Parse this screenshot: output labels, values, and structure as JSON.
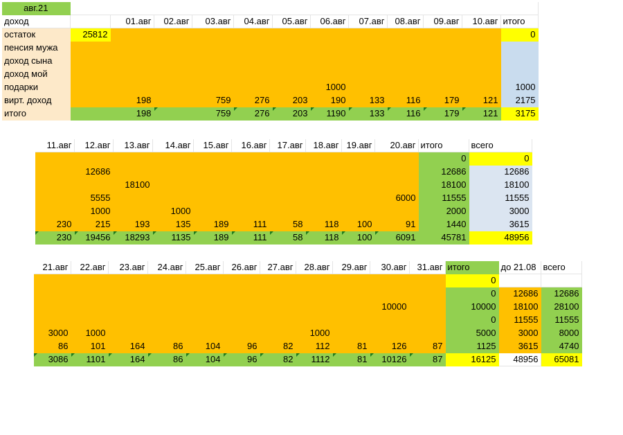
{
  "block1": {
    "title": "авг.21",
    "header": [
      "доход",
      "",
      "01.авг",
      "02.авг",
      "03.авг",
      "04.авг",
      "05.авг",
      "06.авг",
      "07.авг",
      "08.авг",
      "09.авг",
      "10.авг",
      "итого"
    ],
    "rows": [
      [
        "остаток",
        "25812",
        "",
        "",
        "",
        "",
        "",
        "",
        "",
        "",
        "",
        "",
        "0"
      ],
      [
        "пенсия мужа",
        "",
        "",
        "",
        "",
        "",
        "",
        "",
        "",
        "",
        "",
        "",
        ""
      ],
      [
        "доход сына",
        "",
        "",
        "",
        "",
        "",
        "",
        "",
        "",
        "",
        "",
        "",
        ""
      ],
      [
        "доход мой",
        "",
        "",
        "",
        "",
        "",
        "",
        "",
        "",
        "",
        "",
        "",
        ""
      ],
      [
        "подарки",
        "",
        "",
        "",
        "",
        "",
        "",
        "1000",
        "",
        "",
        "",
        "",
        "1000"
      ],
      [
        "вирт. доход",
        "",
        "198",
        "",
        "759",
        "276",
        "203",
        "190",
        "133",
        "116",
        "179",
        "121",
        "2175"
      ],
      [
        "итого",
        "",
        "198",
        "",
        "759",
        "276",
        "203",
        "1190",
        "133",
        "116",
        "179",
        "121",
        "3175"
      ]
    ]
  },
  "block2": {
    "header": [
      "11.авг",
      "12.авг",
      "13.авг",
      "14.авг",
      "15.авг",
      "16.авг",
      "17.авг",
      "18.авг",
      "19.авг",
      "20.авг",
      "итого",
      "всего"
    ],
    "rows": [
      [
        "",
        "",
        "",
        "",
        "",
        "",
        "",
        "",
        "",
        "",
        "0",
        "0"
      ],
      [
        "",
        "12686",
        "",
        "",
        "",
        "",
        "",
        "",
        "",
        "",
        "12686",
        "12686"
      ],
      [
        "",
        "",
        "18100",
        "",
        "",
        "",
        "",
        "",
        "",
        "",
        "18100",
        "18100"
      ],
      [
        "",
        "5555",
        "",
        "",
        "",
        "",
        "",
        "",
        "",
        "6000",
        "11555",
        "11555"
      ],
      [
        "",
        "1000",
        "",
        "1000",
        "",
        "",
        "",
        "",
        "",
        "",
        "2000",
        "3000"
      ],
      [
        "230",
        "215",
        "193",
        "135",
        "189",
        "111",
        "58",
        "118",
        "100",
        "91",
        "1440",
        "3615"
      ],
      [
        "230",
        "19456",
        "18293",
        "1135",
        "189",
        "111",
        "58",
        "118",
        "100",
        "6091",
        "45781",
        "48956"
      ]
    ]
  },
  "block3": {
    "header": [
      "21.авг",
      "22.авг",
      "23.авг",
      "24.авг",
      "25.авг",
      "26.авг",
      "27.авг",
      "28.авг",
      "29.авг",
      "30.авг",
      "31.авг",
      "итого",
      "до 21.08",
      "всего"
    ],
    "rows": [
      [
        "",
        "",
        "",
        "",
        "",
        "",
        "",
        "",
        "",
        "",
        "",
        "0",
        "",
        ""
      ],
      [
        "",
        "",
        "",
        "",
        "",
        "",
        "",
        "",
        "",
        "",
        "",
        "0",
        "12686",
        "12686"
      ],
      [
        "",
        "",
        "",
        "",
        "",
        "",
        "",
        "",
        "",
        "10000",
        "",
        "10000",
        "18100",
        "28100"
      ],
      [
        "",
        "",
        "",
        "",
        "",
        "",
        "",
        "",
        "",
        "",
        "",
        "0",
        "11555",
        "11555"
      ],
      [
        "3000",
        "1000",
        "",
        "",
        "",
        "",
        "",
        "1000",
        "",
        "",
        "",
        "5000",
        "3000",
        "8000"
      ],
      [
        "86",
        "101",
        "164",
        "86",
        "104",
        "96",
        "82",
        "112",
        "81",
        "126",
        "87",
        "1125",
        "3615",
        "4740"
      ],
      [
        "3086",
        "1101",
        "164",
        "86",
        "104",
        "96",
        "82",
        "1112",
        "81",
        "10126",
        "87",
        "16125",
        "48956",
        "65081"
      ]
    ]
  }
}
